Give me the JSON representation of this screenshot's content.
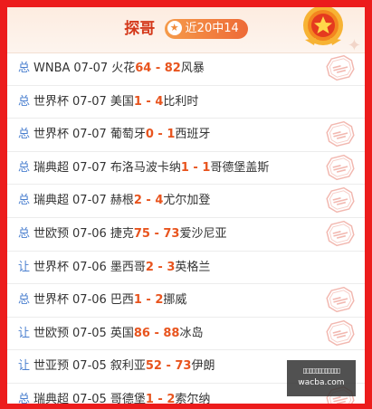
{
  "header": {
    "expert_name": "探哥",
    "record": "近20中14"
  },
  "matches": [
    {
      "type": "总",
      "league": "WNBA",
      "date": "07-07",
      "home": "火花",
      "home_score": "64",
      "away_score": "82",
      "away": "风暴",
      "hit": true
    },
    {
      "type": "总",
      "league": "世界杯",
      "date": "07-07",
      "home": "美国",
      "home_score": "1",
      "away_score": "4",
      "away": "比利时",
      "hit": false
    },
    {
      "type": "总",
      "league": "世界杯",
      "date": "07-07",
      "home": "葡萄牙",
      "home_score": "0",
      "away_score": "1",
      "away": "西班牙",
      "hit": true
    },
    {
      "type": "总",
      "league": "瑞典超",
      "date": "07-07",
      "home": "布洛马波卡纳",
      "home_score": "1",
      "away_score": "1",
      "away": "哥德堡盖斯",
      "hit": true
    },
    {
      "type": "总",
      "league": "瑞典超",
      "date": "07-07",
      "home": "赫根",
      "home_score": "2",
      "away_score": "4",
      "away": "尤尔加登",
      "hit": true
    },
    {
      "type": "总",
      "league": "世欧预",
      "date": "07-06",
      "home": "捷克",
      "home_score": "75",
      "away_score": "73",
      "away": "爱沙尼亚",
      "hit": true
    },
    {
      "type": "让",
      "league": "世界杯",
      "date": "07-06",
      "home": "墨西哥",
      "home_score": "2",
      "away_score": "3",
      "away": "英格兰",
      "hit": false
    },
    {
      "type": "总",
      "league": "世界杯",
      "date": "07-06",
      "home": "巴西",
      "home_score": "1",
      "away_score": "2",
      "away": "挪威",
      "hit": true
    },
    {
      "type": "让",
      "league": "世欧预",
      "date": "07-05",
      "home": "英国",
      "home_score": "86",
      "away_score": "88",
      "away": "冰岛",
      "hit": true
    },
    {
      "type": "让",
      "league": "世亚预",
      "date": "07-05",
      "home": "叙利亚",
      "home_score": "52",
      "away_score": "73",
      "away": "伊朗",
      "hit": false
    },
    {
      "type": "总",
      "league": "瑞典超",
      "date": "07-05",
      "home": "哥德堡",
      "home_score": "1",
      "away_score": "2",
      "away": "索尔纳",
      "hit": true
    }
  ],
  "watermark": {
    "domain": "wacba.com"
  },
  "colors": {
    "frame": "#ec1c1c",
    "expert_name": "#d4391b",
    "score": "#e8541e",
    "type": "#4a7fcf",
    "badge": "#f08a3a"
  },
  "icons": {
    "medal": "gold-star-medal-icon",
    "stamp": "hit-stamp-icon",
    "star": "star-icon"
  }
}
